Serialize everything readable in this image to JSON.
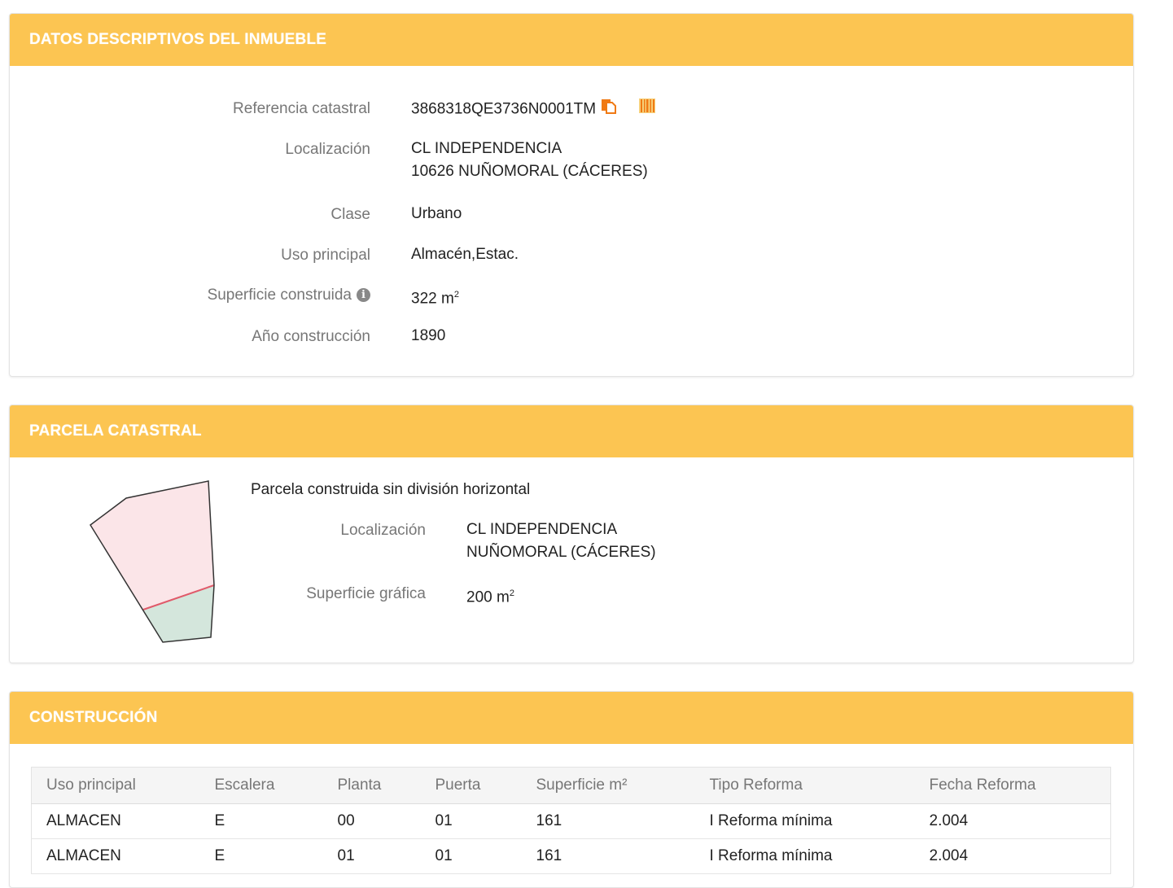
{
  "datos": {
    "title": "DATOS DESCRIPTIVOS DEL INMUEBLE",
    "ref_label": "Referencia catastral",
    "ref_value": "3868318QE3736N0001TM",
    "loc_label": "Localización",
    "loc_line1": "CL INDEPENDENCIA",
    "loc_line2": "10626 NUÑOMORAL (CÁCERES)",
    "clase_label": "Clase",
    "clase_value": "Urbano",
    "uso_label": "Uso principal",
    "uso_value": "Almacén,Estac.",
    "sup_label": "Superficie construida",
    "sup_value": "322 m",
    "sup_exp": "2",
    "anio_label": "Año construcción",
    "anio_value": "1890"
  },
  "parcela": {
    "title": "PARCELA CATASTRAL",
    "subtitle": "Parcela construida sin división horizontal",
    "loc_label": "Localización",
    "loc_line1": "CL INDEPENDENCIA",
    "loc_line2": "NUÑOMORAL (CÁCERES)",
    "sup_label": "Superficie gráfica",
    "sup_value": "200 m",
    "sup_exp": "2"
  },
  "construccion": {
    "title": "CONSTRUCCIÓN",
    "columns": [
      "Uso principal",
      "Escalera",
      "Planta",
      "Puerta",
      "Superficie m²",
      "Tipo Reforma",
      "Fecha Reforma"
    ],
    "rows": [
      [
        "ALMACEN",
        "E",
        "00",
        "01",
        "161",
        "I Reforma mínima",
        "2.004"
      ],
      [
        "ALMACEN",
        "E",
        "01",
        "01",
        "161",
        "I Reforma mínima",
        "2.004"
      ]
    ]
  },
  "colors": {
    "header": "#fcc552",
    "parcel_fill_upper": "#fbe5e8",
    "parcel_fill_lower": "#d4e6dc",
    "parcel_divider": "#e05a6a"
  },
  "icons": [
    "copy-icon",
    "barcode-icon",
    "info-icon"
  ]
}
